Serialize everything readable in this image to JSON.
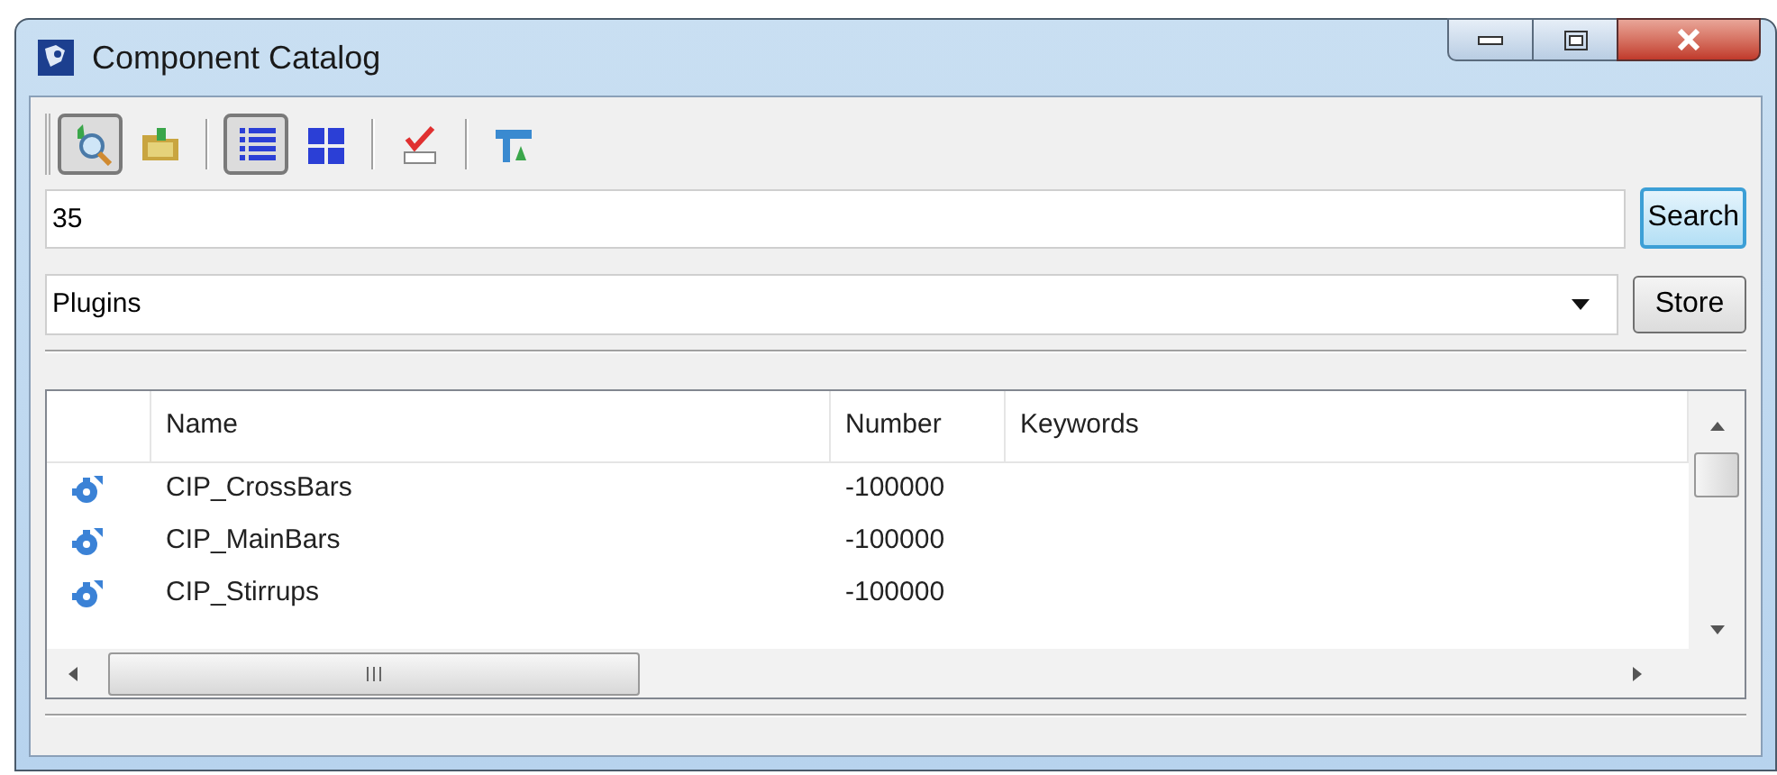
{
  "window": {
    "title": "Component Catalog"
  },
  "toolbar": [
    {
      "kind": "search",
      "pressed": true
    },
    {
      "kind": "folder",
      "pressed": false
    },
    {
      "kind": "separator"
    },
    {
      "kind": "list",
      "pressed": true
    },
    {
      "kind": "tiles",
      "pressed": false
    },
    {
      "kind": "separator"
    },
    {
      "kind": "spellcheck",
      "pressed": false
    },
    {
      "kind": "separator"
    },
    {
      "kind": "filter",
      "pressed": false
    }
  ],
  "search": {
    "value": "35",
    "button": "Search"
  },
  "source": {
    "value": "Plugins",
    "button": "Store"
  },
  "table": {
    "columns": [
      "Name",
      "Number",
      "Keywords"
    ],
    "rows": [
      {
        "name": "CIP_CrossBars",
        "number": "-100000"
      },
      {
        "name": "CIP_MainBars",
        "number": "-100000"
      },
      {
        "name": "CIP_Stirrups",
        "number": "-100000"
      }
    ]
  }
}
